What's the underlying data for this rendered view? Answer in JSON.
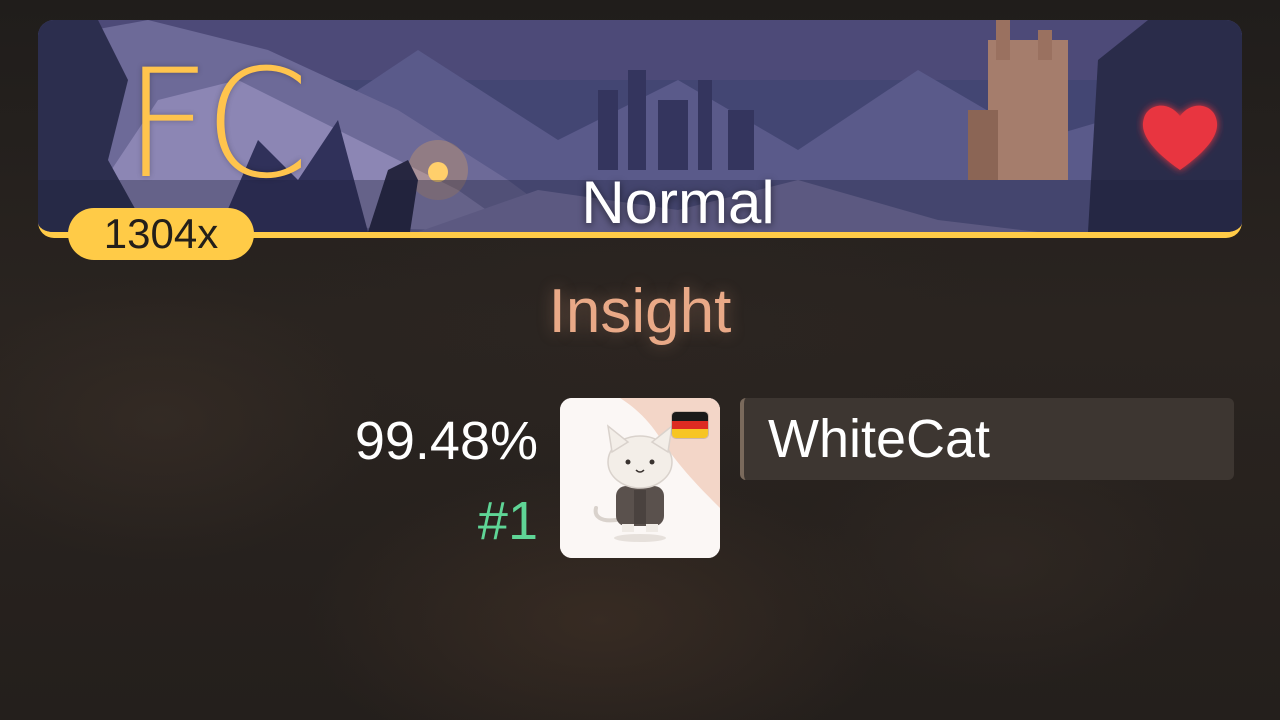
{
  "score": {
    "grade": "FC",
    "difficulty": "Normal",
    "combo": "1304x",
    "favorited": true
  },
  "song": {
    "title": "Insight"
  },
  "player": {
    "accuracy": "99.48%",
    "rank": "#1",
    "username": "WhiteCat",
    "country_flag": "germany-flag-icon"
  },
  "colors": {
    "accent": "#ffcb47",
    "song_title": "#e9a987",
    "rank": "#5fd596",
    "heart": "#e8343f"
  }
}
